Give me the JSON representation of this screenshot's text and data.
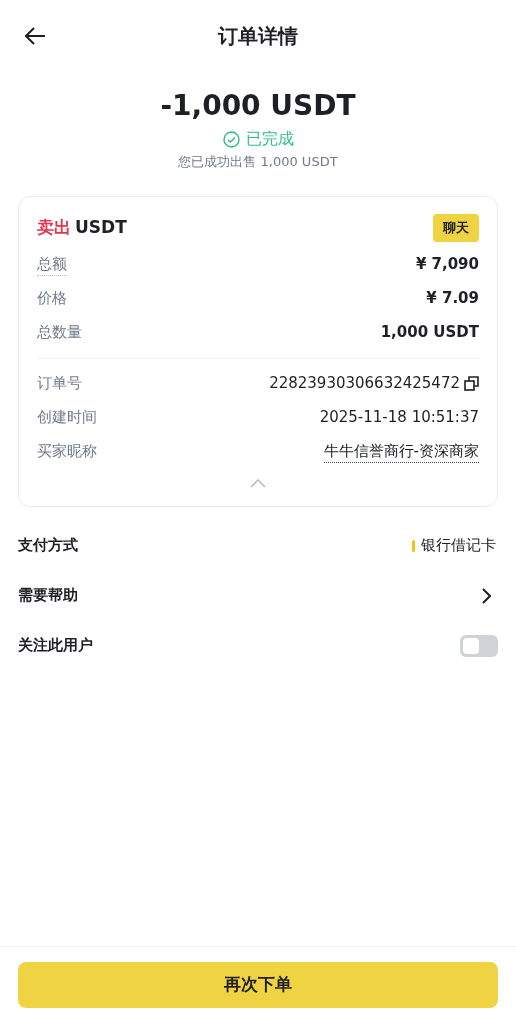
{
  "header": {
    "title": "订单详情"
  },
  "summary": {
    "amount": "-1,000 USDT",
    "status": "已完成",
    "completed": true,
    "note": "您已成功出售 1,000 USDT"
  },
  "order_card": {
    "side": "卖出",
    "asset": "USDT",
    "chat_button": "聊天",
    "expanded": true,
    "rows": [
      {
        "label": "总额",
        "value": "¥ 7,090",
        "kind": "plain",
        "underlined_label": true
      },
      {
        "label": "价格",
        "value": "¥ 7.09",
        "kind": "plain",
        "underlined_label": false
      },
      {
        "label": "总数量",
        "value": "1,000 USDT",
        "kind": "plain",
        "underlined_label": false
      },
      {
        "kind": "divider"
      },
      {
        "label": "订单号",
        "value": "22823930306632425472",
        "kind": "copy",
        "underlined_label": false
      },
      {
        "label": "创建时间",
        "value": "2025-11-18 10:51:37",
        "kind": "light",
        "underlined_label": false
      },
      {
        "label": "买家昵称",
        "value": "牛牛信誉商行-资深商家",
        "kind": "link",
        "underlined_label": false
      }
    ]
  },
  "settings": [
    {
      "label": "支付方式",
      "kind": "payment",
      "value": "银行借记卡",
      "color": "#f0c419"
    },
    {
      "label": "需要帮助",
      "kind": "link"
    },
    {
      "label": "关注此用户",
      "kind": "toggle",
      "on": false
    }
  ],
  "footer": {
    "button": "再次下单"
  }
}
